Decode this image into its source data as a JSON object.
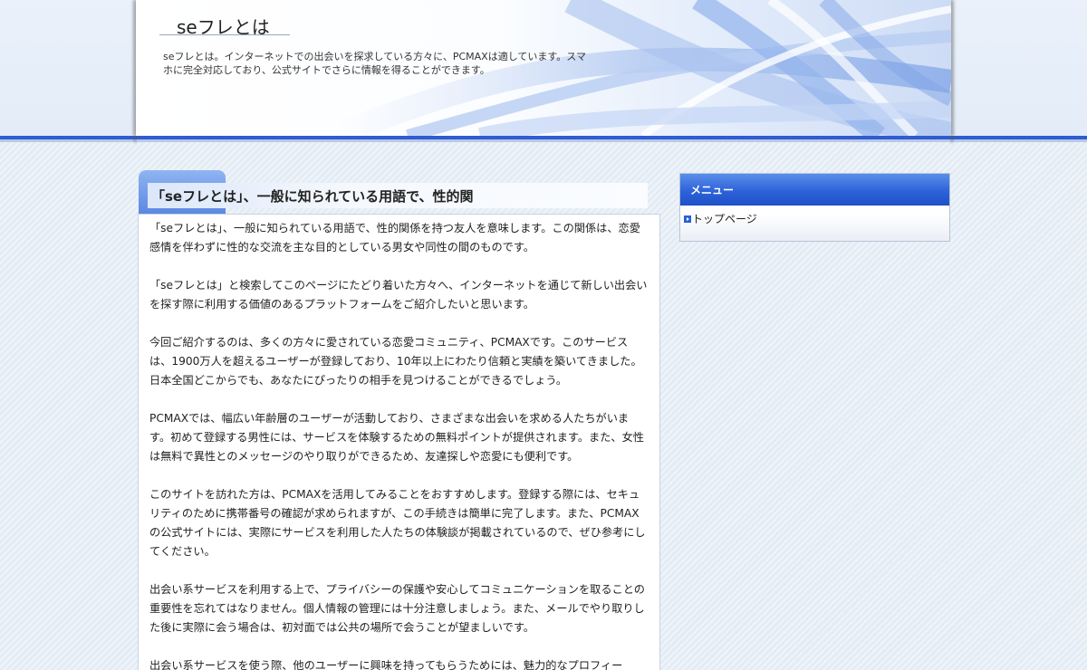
{
  "header": {
    "site_title": "seフレとは",
    "description": "seフレとは。インターネットでの出会いを探求している方々に、PCMAXは適しています。スマホに完全対応しており、公式サイトでさらに情報を得ることができます。"
  },
  "article": {
    "title": "「seフレとは」、一般に知られている用語で、性的関",
    "paragraphs": [
      "「seフレとは」、一般に知られている用語で、性的関係を持つ友人を意味します。この関係は、恋愛感情を伴わずに性的な交流を主な目的としている男女や同性の間のものです。",
      "「seフレとは」と検索してこのページにたどり着いた方々へ、インターネットを通じて新しい出会いを探す際に利用する価値のあるプラットフォームをご紹介したいと思います。",
      "今回ご紹介するのは、多くの方々に愛されている恋愛コミュニティ、PCMAXです。このサービスは、1900万人を超えるユーザーが登録しており、10年以上にわたり信頼と実績を築いてきました。日本全国どこからでも、あなたにぴったりの相手を見つけることができるでしょう。",
      "PCMAXでは、幅広い年齢層のユーザーが活動しており、さまざまな出会いを求める人たちがいます。初めて登録する男性には、サービスを体験するための無料ポイントが提供されます。また、女性は無料で異性とのメッセージのやり取りができるため、友達探しや恋愛にも便利です。",
      "このサイトを訪れた方は、PCMAXを活用してみることをおすすめします。登録する際には、セキュリティのために携帯番号の確認が求められますが、この手続きは簡単に完了します。また、PCMAXの公式サイトには、実際にサービスを利用した人たちの体験談が掲載されているので、ぜひ参考にしてください。",
      "出会い系サービスを利用する上で、プライバシーの保護や安心してコミュニケーションを取ることの重要性を忘れてはなりません。個人情報の管理には十分注意しましょう。また、メールでやり取りした後に実際に会う場合は、初対面では公共の場所で会うことが望ましいです。",
      "出会い系サービスを使う際、他のユーザーに興味を持ってもらうためには、魅力的なプロフィー"
    ]
  },
  "sidebar": {
    "menu_title": "メニュー",
    "items": [
      {
        "label": "トップページ",
        "icon": "arrow-right-icon"
      }
    ]
  },
  "colors": {
    "accent": "#2f5cd1",
    "menu_header": "#2d62d9"
  }
}
